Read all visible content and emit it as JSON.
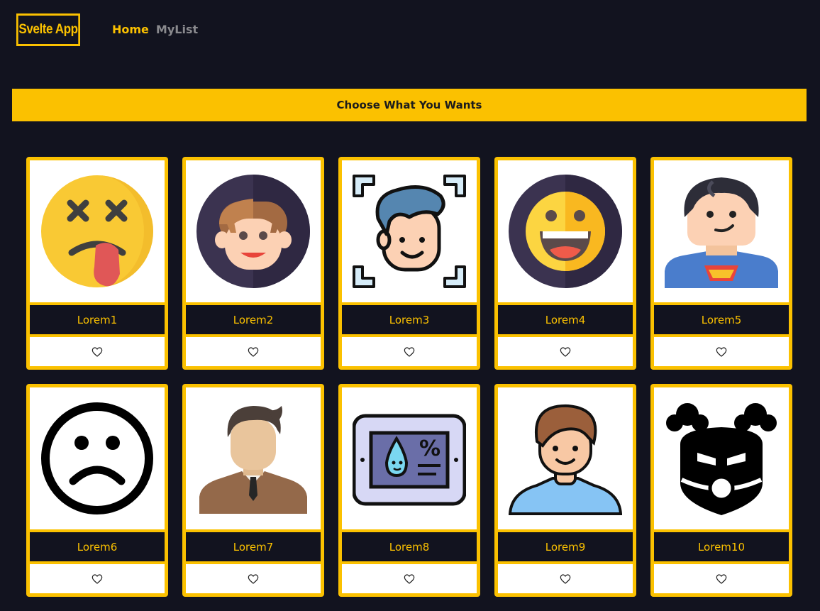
{
  "app": {
    "brand": "Svelte App"
  },
  "nav": {
    "home": "Home",
    "mylist": "MyList"
  },
  "banner": {
    "text": "Choose What You Wants"
  },
  "cards": [
    {
      "title": "Lorem1",
      "icon": "dizzy-tongue-emoji-icon"
    },
    {
      "title": "Lorem2",
      "icon": "boy-avatar-icon"
    },
    {
      "title": "Lorem3",
      "icon": "face-scan-icon"
    },
    {
      "title": "Lorem4",
      "icon": "laughing-emoji-icon"
    },
    {
      "title": "Lorem5",
      "icon": "superhero-avatar-icon"
    },
    {
      "title": "Lorem6",
      "icon": "sad-face-icon"
    },
    {
      "title": "Lorem7",
      "icon": "businessman-avatar-icon"
    },
    {
      "title": "Lorem8",
      "icon": "humidity-display-icon"
    },
    {
      "title": "Lorem9",
      "icon": "man-avatar-icon"
    },
    {
      "title": "Lorem10",
      "icon": "masked-villain-icon"
    }
  ],
  "colors": {
    "background": "#12131f",
    "accent": "#fbc100",
    "muted": "#8a8a8e"
  }
}
